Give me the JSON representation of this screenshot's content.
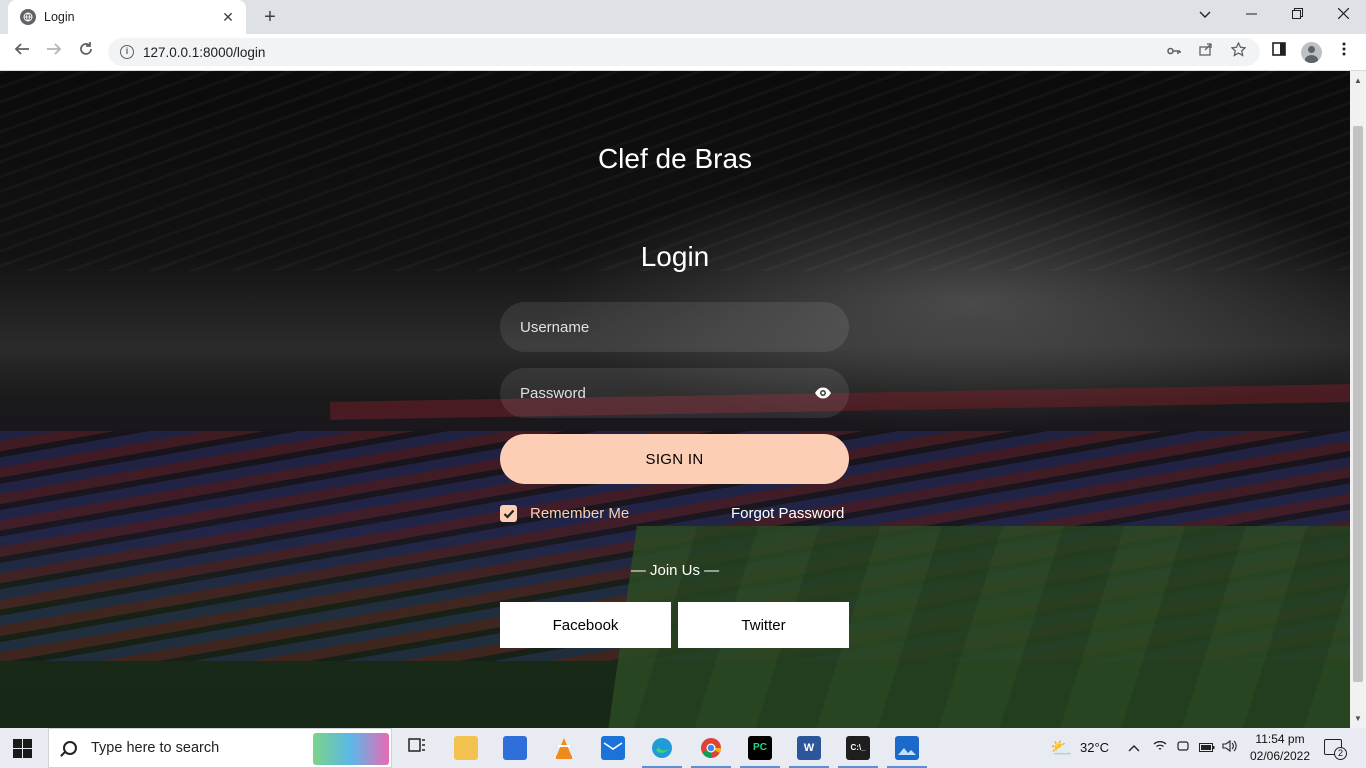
{
  "browser": {
    "tab_title": "Login",
    "url": "127.0.0.1:8000/login",
    "new_tab_symbol": "+",
    "close_symbol": "✕"
  },
  "page": {
    "site_title": "Clef de Bras",
    "heading": "Login",
    "username_placeholder": "Username",
    "password_placeholder": "Password",
    "signin_label": "SIGN IN",
    "remember_label": "Remember Me",
    "remember_checked": true,
    "forgot_label": "Forgot Password",
    "join_label": "— Join Us —",
    "facebook_label": "Facebook",
    "twitter_label": "Twitter"
  },
  "taskbar": {
    "search_placeholder": "Type here to search",
    "weather": "32°C",
    "time": "11:54 pm",
    "date": "02/06/2022",
    "notification_count": "2",
    "apps": [
      "task-view-icon",
      "file-explorer-icon",
      "store-icon",
      "vlc-icon",
      "mail-icon",
      "edge-icon",
      "chrome-icon",
      "pycharm-icon",
      "word-icon",
      "terminal-icon",
      "photos-icon"
    ]
  },
  "colors": {
    "accent": "#fbceb5",
    "page_bg": "#000000",
    "taskbar_bg": "#e8ecf2"
  }
}
